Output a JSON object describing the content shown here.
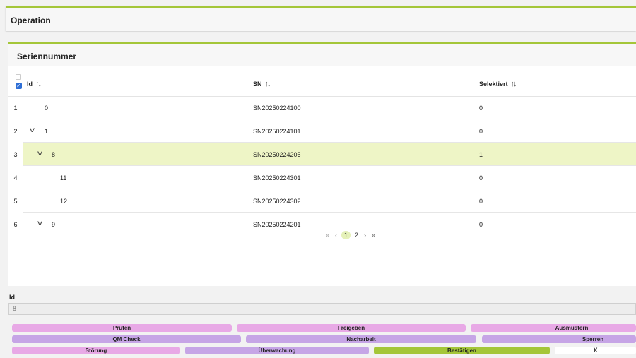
{
  "operation": {
    "title": "Operation"
  },
  "serial_panel": {
    "title": "Seriennummer",
    "columns": {
      "id": "Id",
      "sn": "SN",
      "selected": "Selektiert"
    },
    "sort_icon": "↑↓",
    "rows": [
      {
        "num": "1",
        "id": "0",
        "sn": "SN20250224100",
        "sel": "0"
      },
      {
        "num": "2",
        "id": "1",
        "sn": "SN20250224101",
        "sel": "0"
      },
      {
        "num": "3",
        "id": "8",
        "sn": "SN20250224205",
        "sel": "1"
      },
      {
        "num": "4",
        "id": "11",
        "sn": "SN20250224301",
        "sel": "0"
      },
      {
        "num": "5",
        "id": "12",
        "sn": "SN20250224302",
        "sel": "0"
      },
      {
        "num": "6",
        "id": "9",
        "sn": "SN20250224201",
        "sel": "0"
      }
    ],
    "pagination": {
      "first": "«",
      "prev": "‹",
      "page1": "1",
      "page2": "2",
      "next": "›",
      "last": "»"
    }
  },
  "id_field": {
    "label": "Id",
    "value": "8"
  },
  "actions": {
    "pruefen": "Prüfen",
    "freigeben": "Freigeben",
    "ausmustern": "Ausmustern",
    "qm_check": "QM Check",
    "nacharbeit": "Nacharbeit",
    "sperren": "Sperren",
    "stoerung": "Störung",
    "ueberwachung": "Überwachung",
    "bestaetigen": "Bestätigen",
    "close": "X"
  },
  "colors": {
    "accent": "#a4c639",
    "selected_row": "#eef5c6",
    "pink_button": "#e8a9e6",
    "purple_button": "#c6a5e6"
  }
}
